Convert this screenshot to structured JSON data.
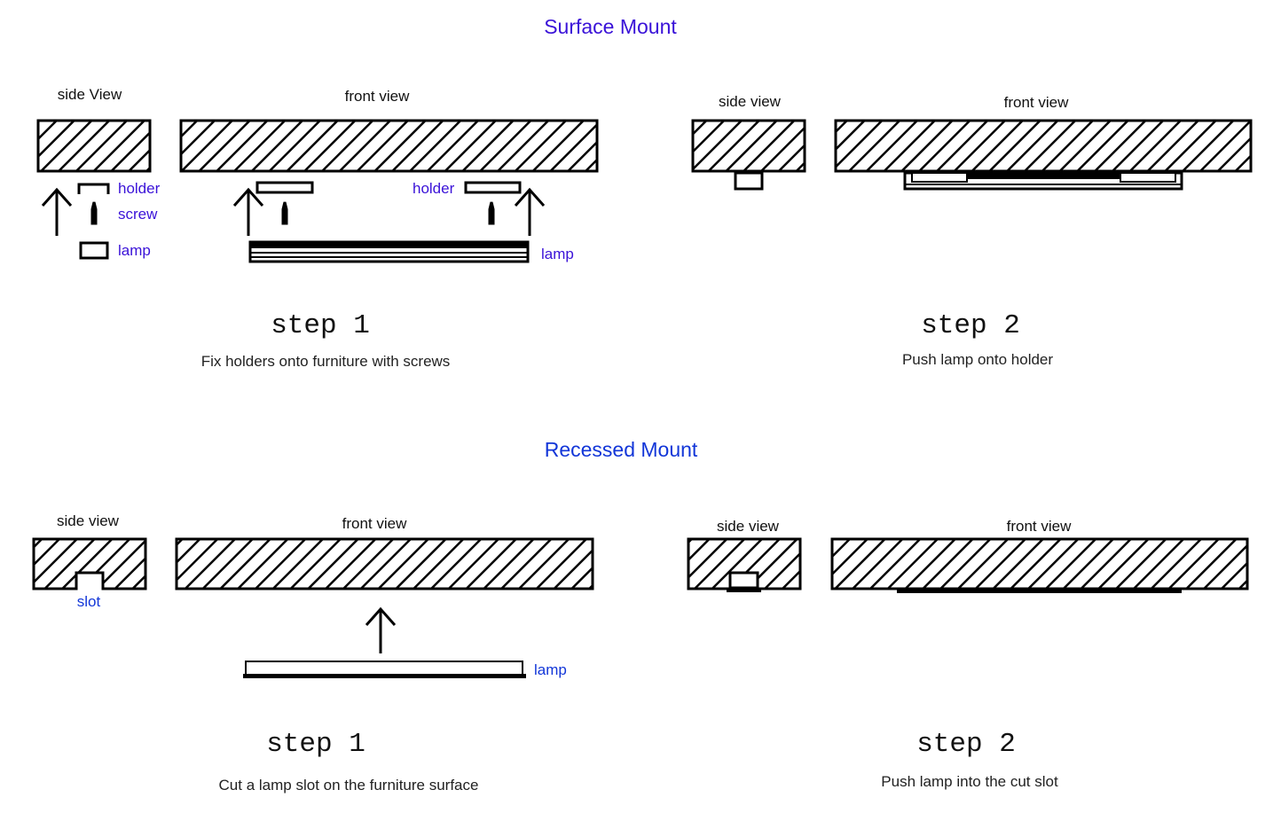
{
  "surface": {
    "title": "Surface Mount",
    "step1": {
      "side_label": "side View",
      "front_label": "front view",
      "holder": "holder",
      "screw": "screw",
      "lamp": "lamp",
      "front_holder": "holder",
      "front_lamp": "lamp",
      "step": "step 1",
      "caption": "Fix holders onto furniture with screws"
    },
    "step2": {
      "side_label": "side view",
      "front_label": "front view",
      "step": "step 2",
      "caption": "Push lamp onto holder"
    }
  },
  "recessed": {
    "title": "Recessed Mount",
    "step1": {
      "side_label": "side view",
      "front_label": "front view",
      "slot": "slot",
      "lamp": "lamp",
      "step": "step 1",
      "caption": "Cut a lamp slot on the furniture surface"
    },
    "step2": {
      "side_label": "side view",
      "front_label": "front view",
      "step": "step 2",
      "caption": "Push lamp into the cut slot"
    }
  },
  "colors": {
    "label_blue": "#3a12d8",
    "label_blue_alt": "#1236d8"
  }
}
